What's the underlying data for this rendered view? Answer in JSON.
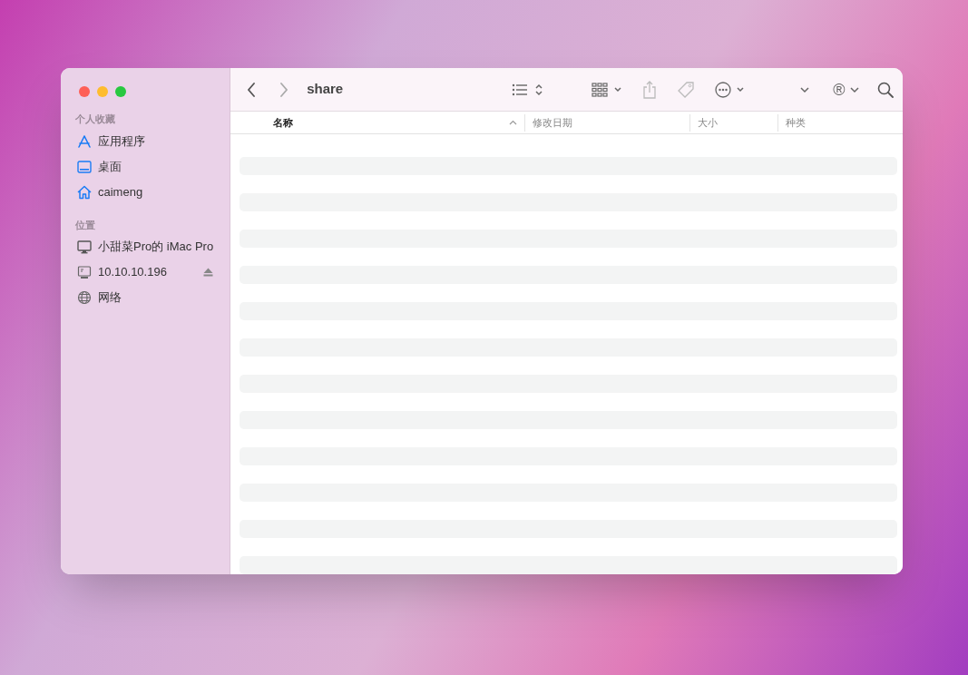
{
  "window": {
    "title": "share"
  },
  "sidebar": {
    "sections": [
      {
        "title": "个人收藏",
        "items": [
          {
            "label": "应用程序",
            "kind": "apps",
            "ejectable": false
          },
          {
            "label": "桌面",
            "kind": "desktop",
            "ejectable": false
          },
          {
            "label": "caimeng",
            "kind": "home",
            "ejectable": false
          }
        ]
      },
      {
        "title": "位置",
        "items": [
          {
            "label": "小甜菜Pro的 iMac Pro",
            "kind": "computer",
            "ejectable": false
          },
          {
            "label": "10.10.10.196",
            "kind": "server",
            "ejectable": true
          },
          {
            "label": "网络",
            "kind": "network",
            "ejectable": false
          }
        ]
      }
    ]
  },
  "toolbar": {
    "account_glyph": "®"
  },
  "table": {
    "columns": [
      {
        "label": "名称",
        "sorted": true
      },
      {
        "label": "修改日期",
        "sorted": false
      },
      {
        "label": "大小",
        "sorted": false
      },
      {
        "label": "种类",
        "sorted": false
      }
    ]
  }
}
